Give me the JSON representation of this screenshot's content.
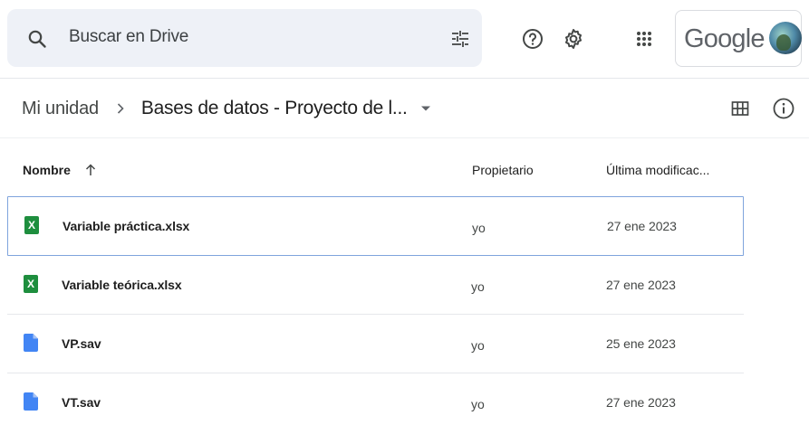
{
  "search": {
    "placeholder": "Buscar en Drive"
  },
  "account": {
    "brand": "Google"
  },
  "breadcrumb": {
    "root": "Mi unidad",
    "current": "Bases de datos - Proyecto de l..."
  },
  "columns": {
    "name": "Nombre",
    "owner": "Propietario",
    "modified": "Última modificac..."
  },
  "files": [
    {
      "name": "Variable práctica.xlsx",
      "type": "spreadsheet",
      "owner": "yo",
      "modified": "27 ene 2023",
      "selected": true
    },
    {
      "name": "Variable teórica.xlsx",
      "type": "spreadsheet",
      "owner": "yo",
      "modified": "27 ene 2023",
      "selected": false
    },
    {
      "name": "VP.sav",
      "type": "file",
      "owner": "yo",
      "modified": "25 ene 2023",
      "selected": false
    },
    {
      "name": "VT.sav",
      "type": "file",
      "owner": "yo",
      "modified": "27 ene 2023",
      "selected": false
    }
  ],
  "colors": {
    "spreadsheet": "#1e8e3e",
    "file": "#4285f4",
    "selection_border": "#7fa4dd",
    "search_bg": "#eef1f7"
  },
  "icons": {
    "spreadsheet_glyph": "X"
  }
}
